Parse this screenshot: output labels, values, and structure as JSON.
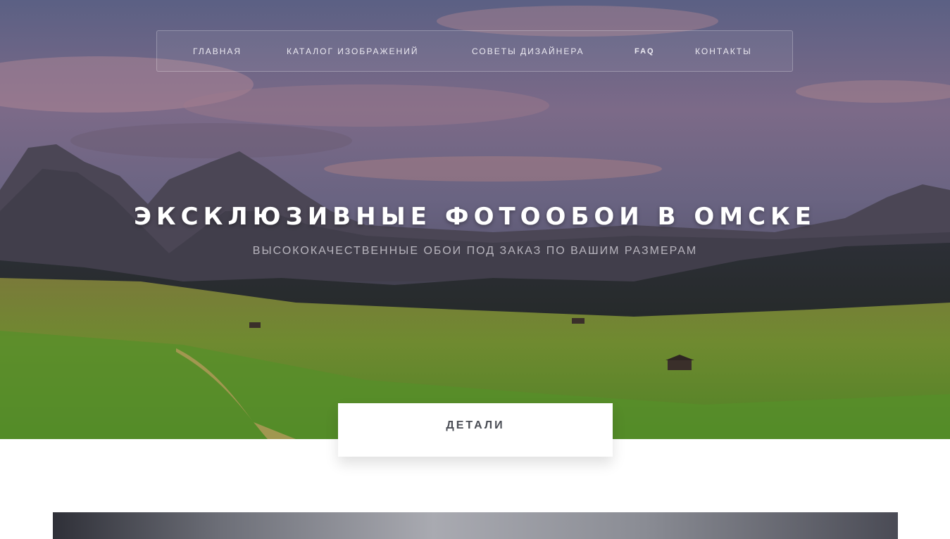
{
  "nav": {
    "items": [
      {
        "label": "ГЛАВНАЯ"
      },
      {
        "label": "КАТАЛОГ ИЗОБРАЖЕНИЙ"
      },
      {
        "label": "СОВЕТЫ ДИЗАЙНЕРА"
      },
      {
        "label": "FAQ"
      },
      {
        "label": "КОНТАКТЫ"
      }
    ]
  },
  "hero": {
    "title": "ЭКСКЛЮЗИВНЫЕ ФОТООБОИ В ОМСКЕ",
    "subtitle": "ВЫСОКОКАЧЕСТВЕННЫЕ ОБОИ ПОД ЗАКАЗ ПО ВАШИМ РАЗМЕРАМ",
    "cta_label": "ДЕТАЛИ"
  },
  "colors": {
    "cta_text": "#4a4d55",
    "nav_text": "#eceaf2",
    "subtitle_text": "#b9b6bf"
  }
}
